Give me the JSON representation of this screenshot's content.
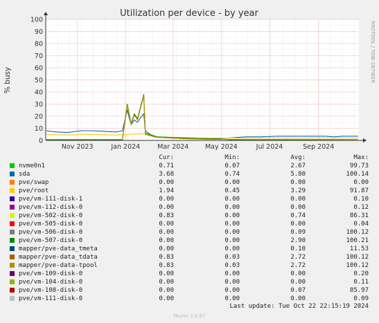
{
  "chart_data": {
    "type": "line",
    "title": "Utilization per device - by year",
    "ylabel": "% busy",
    "ylim": [
      0,
      100
    ],
    "yticks": [
      "0",
      "10",
      "20",
      "30",
      "40",
      "50",
      "60",
      "70",
      "80",
      "90",
      "100"
    ],
    "xlim": [
      "2023-09-22",
      "2024-10-22"
    ],
    "xticks": [
      {
        "date": "2023-11-01",
        "label": "Nov 2023"
      },
      {
        "date": "2024-01-01",
        "label": "Jan 2024"
      },
      {
        "date": "2024-03-01",
        "label": "Mar 2024"
      },
      {
        "date": "2024-05-01",
        "label": "May 2024"
      },
      {
        "date": "2024-07-01",
        "label": "Jul 2024"
      },
      {
        "date": "2024-09-01",
        "label": "Sep 2024"
      }
    ],
    "grid": true,
    "columns": [
      "Cur:",
      "Min:",
      "Avg:",
      "Max:"
    ],
    "series": [
      {
        "name": "nvme0n1",
        "color": "#00cc00",
        "cur": "0.71",
        "min": "0.07",
        "avg": "2.67",
        "max": "99.73"
      },
      {
        "name": "sda",
        "color": "#0066b3",
        "cur": "3.68",
        "min": "0.74",
        "avg": "5.80",
        "max": "100.14",
        "x": [
          "2023-09-23",
          "2023-10-05",
          "2023-10-20",
          "2023-11-05",
          "2023-11-20",
          "2023-12-05",
          "2023-12-20",
          "2023-12-28",
          "2024-01-03",
          "2024-01-08",
          "2024-01-12",
          "2024-01-16",
          "2024-01-20",
          "2024-01-24",
          "2024-01-26",
          "2024-02-05",
          "2024-02-20",
          "2024-03-10",
          "2024-04-01",
          "2024-04-20",
          "2024-05-10",
          "2024-06-01",
          "2024-06-20",
          "2024-07-10",
          "2024-08-01",
          "2024-08-20",
          "2024-09-10",
          "2024-09-20",
          "2024-10-01",
          "2024-10-21"
        ],
        "y": [
          8,
          7,
          6.5,
          8,
          8,
          7.5,
          7,
          8,
          25,
          13,
          17,
          15,
          19,
          22,
          8,
          3,
          2.5,
          2,
          1.5,
          1.5,
          2,
          3,
          3,
          3.5,
          3.5,
          3.5,
          3.5,
          3,
          3.5,
          3.5
        ]
      },
      {
        "name": "pve/swap",
        "color": "#ff8000",
        "cur": "0.00",
        "min": "0.00",
        "avg": "0.00",
        "max": "0.00"
      },
      {
        "name": "pve/root",
        "color": "#ffcc00",
        "cur": "1.94",
        "min": "0.45",
        "avg": "3.29",
        "max": "91.87",
        "x": [
          "2023-09-23",
          "2023-10-10",
          "2023-10-25",
          "2023-11-10",
          "2023-11-25",
          "2023-12-10",
          "2023-12-25",
          "2024-01-05",
          "2024-01-20",
          "2024-01-26",
          "2024-02-05",
          "2024-03-01",
          "2024-03-15",
          "2024-04-01",
          "2024-05-01",
          "2024-06-01",
          "2024-07-01",
          "2024-08-01",
          "2024-09-01",
          "2024-10-21"
        ],
        "y": [
          5,
          4.5,
          4.5,
          5,
          5,
          4.5,
          4.5,
          5,
          5.5,
          6,
          3,
          2.5,
          2.5,
          2,
          2,
          2,
          2,
          2,
          2,
          2
        ]
      },
      {
        "name": "pve/vm-111-disk-1",
        "color": "#330099",
        "cur": "0.00",
        "min": "0.00",
        "avg": "0.00",
        "max": "0.10"
      },
      {
        "name": "pve/vm-112-disk-0",
        "color": "#990099",
        "cur": "0.00",
        "min": "0.00",
        "avg": "0.00",
        "max": "0.12"
      },
      {
        "name": "pve/vm-502-disk-0",
        "color": "#ccff00",
        "cur": "0.83",
        "min": "0.00",
        "avg": "0.74",
        "max": "86.31"
      },
      {
        "name": "pve/vm-505-disk-0",
        "color": "#ff0000",
        "cur": "0.00",
        "min": "0.00",
        "avg": "0.00",
        "max": "0.04"
      },
      {
        "name": "pve/vm-506-disk-0",
        "color": "#808080",
        "cur": "0.00",
        "min": "0.00",
        "avg": "0.09",
        "max": "100.12"
      },
      {
        "name": "pve/vm-507-disk-0",
        "color": "#008f00",
        "cur": "0.00",
        "min": "0.00",
        "avg": "2.90",
        "max": "100.21",
        "x": [
          "2023-09-23",
          "2023-12-28",
          "2024-01-03",
          "2024-01-08",
          "2024-01-12",
          "2024-01-16",
          "2024-01-20",
          "2024-01-24",
          "2024-01-26",
          "2024-02-10",
          "2024-03-15",
          "2024-04-15",
          "2024-05-15",
          "2024-10-21"
        ],
        "y": [
          0.5,
          0.5,
          30,
          14,
          22,
          18,
          28,
          38,
          6,
          3,
          2,
          1.5,
          0.5,
          0
        ]
      },
      {
        "name": "mapper/pve-data_tmeta",
        "color": "#00487d",
        "cur": "0.00",
        "min": "0.00",
        "avg": "0.10",
        "max": "11.53"
      },
      {
        "name": "mapper/pve-data_tdata",
        "color": "#b35a00",
        "cur": "0.83",
        "min": "0.03",
        "avg": "2.72",
        "max": "100.12",
        "x": [
          "2023-09-23",
          "2023-12-28",
          "2024-01-03",
          "2024-01-08",
          "2024-01-12",
          "2024-01-16",
          "2024-01-20",
          "2024-01-24",
          "2024-01-26",
          "2024-02-10",
          "2024-03-15",
          "2024-04-15",
          "2024-06-01",
          "2024-08-01",
          "2024-10-21"
        ],
        "y": [
          0.8,
          0.8,
          29,
          13,
          21,
          17,
          27,
          37,
          5,
          2.5,
          1.5,
          1,
          0.8,
          0.8,
          0.8
        ]
      },
      {
        "name": "mapper/pve-data-tpool",
        "color": "#b38f00",
        "cur": "0.83",
        "min": "0.03",
        "avg": "2.72",
        "max": "100.12",
        "x": [
          "2023-09-23",
          "2023-12-28",
          "2024-01-03",
          "2024-01-08",
          "2024-01-12",
          "2024-01-16",
          "2024-01-20",
          "2024-01-24",
          "2024-01-26",
          "2024-02-10",
          "2024-03-15",
          "2024-04-15",
          "2024-06-01",
          "2024-08-01",
          "2024-10-21"
        ],
        "y": [
          0.8,
          0.8,
          29,
          13,
          21,
          17,
          27,
          37,
          5,
          2.5,
          1.5,
          1,
          0.8,
          0.8,
          0.8
        ]
      },
      {
        "name": "pve/vm-109-disk-0",
        "color": "#6b006b",
        "cur": "0.00",
        "min": "0.00",
        "avg": "0.00",
        "max": "0.20"
      },
      {
        "name": "pve/vm-104-disk-0",
        "color": "#8fb300",
        "cur": "0.00",
        "min": "0.00",
        "avg": "0.00",
        "max": "0.11"
      },
      {
        "name": "pve/vm-108-disk-0",
        "color": "#b30000",
        "cur": "0.00",
        "min": "0.00",
        "avg": "0.07",
        "max": "85.97"
      },
      {
        "name": "pve/vm-111-disk-0",
        "color": "#bebebe",
        "cur": "0.00",
        "min": "0.00",
        "avg": "0.00",
        "max": "0.09"
      }
    ]
  },
  "last_update": "Last update: Tue Oct 22 22:15:19 2024",
  "side_text": "RRDTOOL / TOBI OETIKER",
  "footer": "Munin 2.0.67"
}
